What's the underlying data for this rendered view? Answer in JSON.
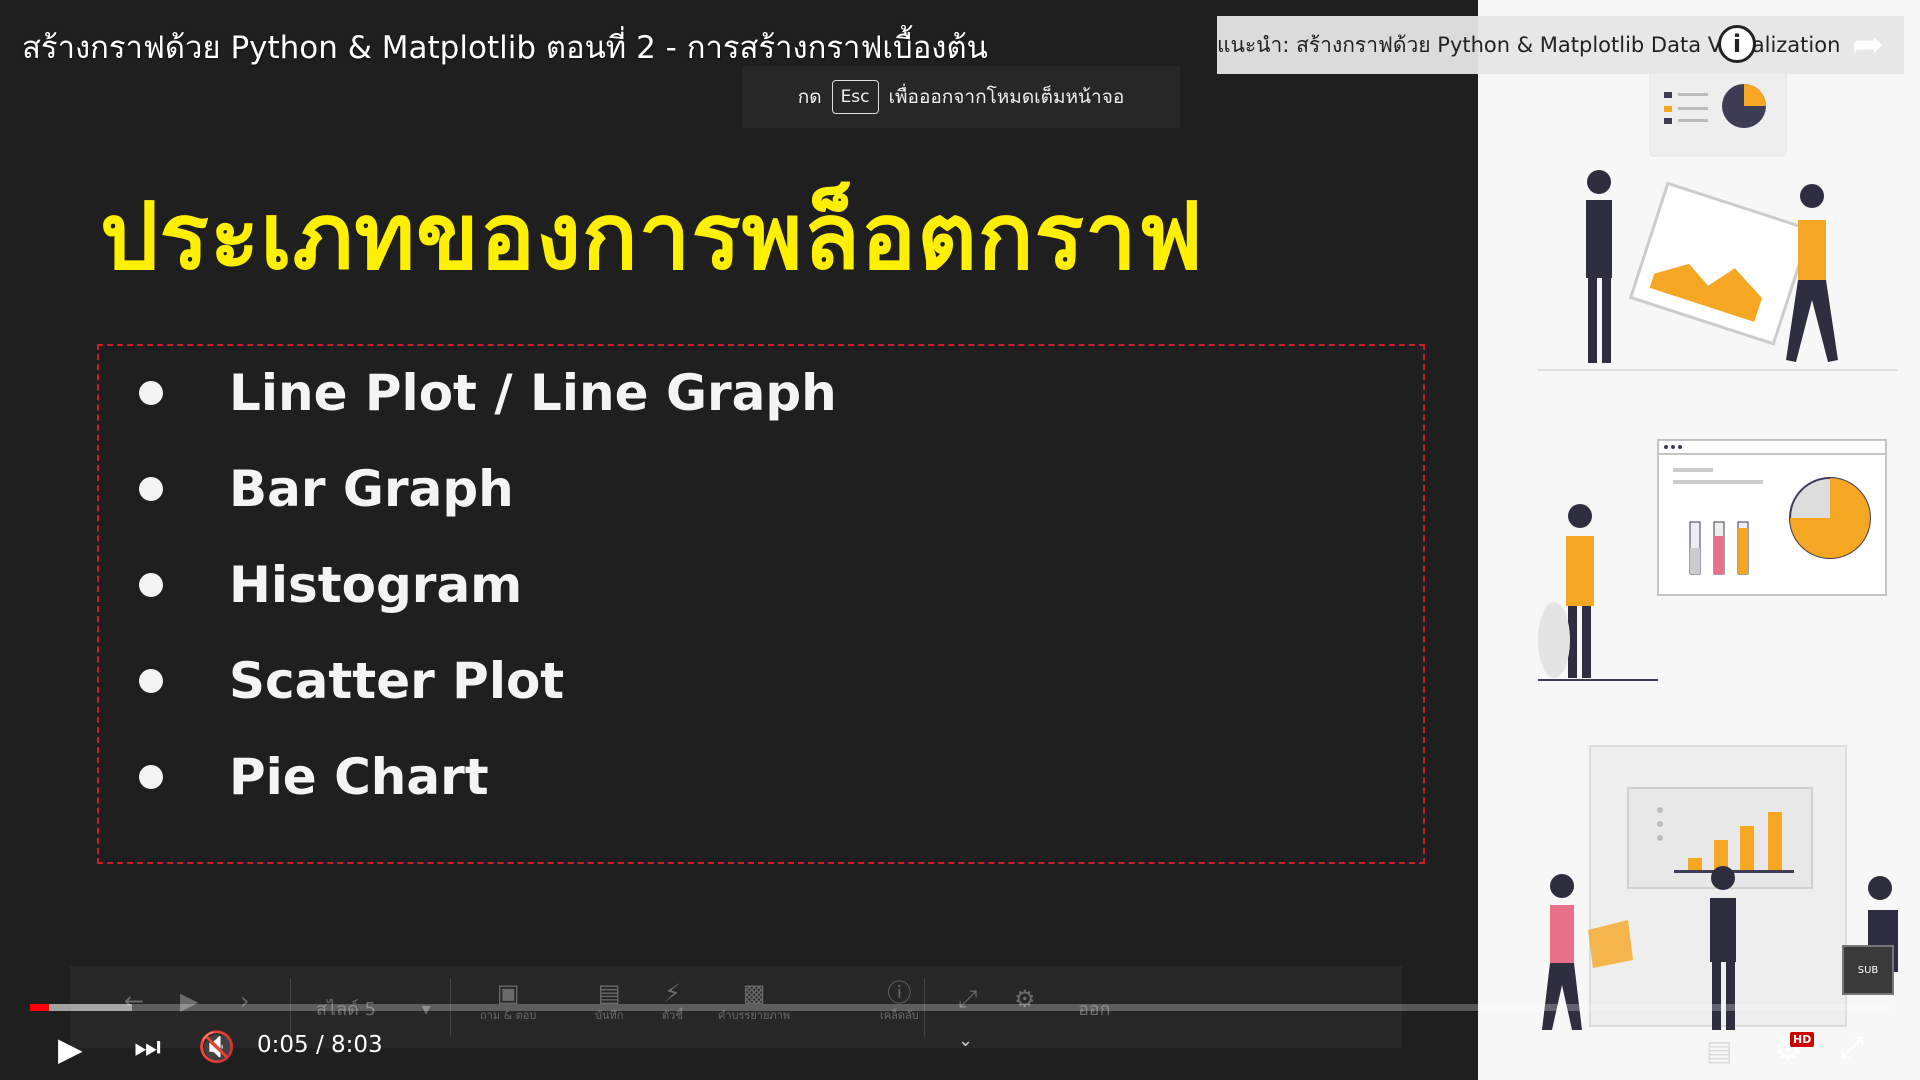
{
  "video": {
    "title": "สร้างกราฟด้วย Python & Matplotlib ตอนที่ 2 - การสร้างกราฟเบื้องต้น",
    "time_display": "0:05 / 8:03",
    "progress": 0.0104
  },
  "fullscreen_hint": {
    "prefix": "กด",
    "key": "Esc",
    "suffix": "เพื่อออกจากโหมดเต็มหน้าจอ"
  },
  "suggestion": {
    "text": "แนะนำ: สร้างกราฟด้วย Python & Matplotlib Data Visualization"
  },
  "slide": {
    "heading": "ประเภทของการพล็อตกราฟ",
    "items": [
      {
        "label": "Line Plot / Line Graph"
      },
      {
        "label": "Bar Graph"
      },
      {
        "label": "Histogram"
      },
      {
        "label": "Scatter Plot"
      },
      {
        "label": "Pie Chart"
      }
    ]
  },
  "slide_toolbar": {
    "slide_label": "สไลด์ 5",
    "qa": "ถาม & ตอบ",
    "notes": "บันทึก",
    "pointer": "ตัวชี้",
    "captions": "คำบรรยายภาพ",
    "shortcuts": "เคล็ดลับ",
    "exit": "ออก"
  },
  "player": {
    "hd_badge": "HD",
    "sub_badge": "SUB"
  },
  "colors": {
    "heading": "#ffef00",
    "dashed_border": "#c81f2a",
    "accent_orange": "#f5a623",
    "progress_red": "#ff0000"
  }
}
